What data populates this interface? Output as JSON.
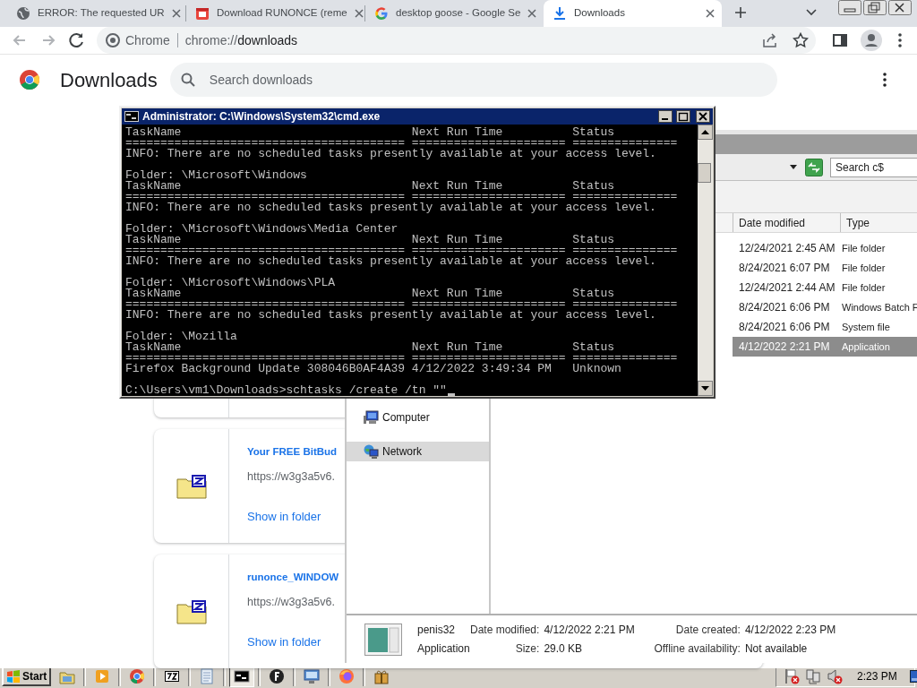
{
  "browser": {
    "tabs": [
      {
        "kind": "globe",
        "title": "ERROR: The requested UR",
        "selected": false
      },
      {
        "kind": "app",
        "title": "Download RUNONCE (reme",
        "selected": false
      },
      {
        "kind": "google",
        "title": "desktop goose - Google Se",
        "selected": false
      },
      {
        "kind": "download",
        "title": "Downloads",
        "selected": true
      }
    ],
    "address": {
      "site_label": "Chrome",
      "prefix": "chrome://",
      "path": "downloads"
    }
  },
  "downloads_page": {
    "title": "Downloads",
    "search": {
      "placeholder": "Search downloads"
    },
    "items": [
      {
        "kind": "covered"
      },
      {
        "kind": "file",
        "name": "Your FREE BitBud",
        "url": "https://w3g3a5v6.",
        "link": "Show in folder"
      },
      {
        "kind": "file",
        "name": "runonce_WINDOW",
        "url": "https://w3g3a5v6.",
        "link": "Show in folder"
      }
    ]
  },
  "explorer": {
    "search": {
      "placeholder": "Search c$"
    },
    "columns": [
      "Date modified",
      "Type"
    ],
    "nav": [
      {
        "label": "Computer",
        "kind": "computer",
        "selected": false
      },
      {
        "label": "Network",
        "kind": "network",
        "selected": true
      }
    ],
    "rows": [
      {
        "date": "12/24/2021 2:45 AM",
        "type": "File folder",
        "selected": false
      },
      {
        "date": "8/24/2021 6:07 PM",
        "type": "File folder",
        "selected": false
      },
      {
        "date": "12/24/2021 2:44 AM",
        "type": "File folder",
        "selected": false
      },
      {
        "date": "8/24/2021 6:06 PM",
        "type": "Windows Batch F",
        "selected": false
      },
      {
        "date": "8/24/2021 6:06 PM",
        "type": "System file",
        "selected": false
      },
      {
        "date": "4/12/2022 2:21 PM",
        "type": "Application",
        "selected": true
      }
    ],
    "details": {
      "name": "penis32",
      "type": "Application",
      "fields": [
        {
          "label": "Date modified:",
          "value": "4/12/2022 2:21 PM"
        },
        {
          "label": "Date created:",
          "value": "4/12/2022 2:23 PM"
        },
        {
          "label": "Size:",
          "value": "29.0 KB"
        },
        {
          "label": "Offline availability:",
          "value": "Not available"
        }
      ]
    }
  },
  "console_window": {
    "title": "Administrator: C:\\Windows\\System32\\cmd.exe",
    "blocks": [
      [
        "TaskName                                 Next Run Time          Status",
        "======================================== ====================== ===============",
        "INFO: There are no scheduled tasks presently available at your access level."
      ],
      [
        "Folder: \\Microsoft\\Windows",
        "TaskName                                 Next Run Time          Status",
        "======================================== ====================== ===============",
        "INFO: There are no scheduled tasks presently available at your access level."
      ],
      [
        "Folder: \\Microsoft\\Windows\\Media Center",
        "TaskName                                 Next Run Time          Status",
        "======================================== ====================== ===============",
        "INFO: There are no scheduled tasks presently available at your access level."
      ],
      [
        "Folder: \\Microsoft\\Windows\\PLA",
        "TaskName                                 Next Run Time          Status",
        "======================================== ====================== ===============",
        "INFO: There are no scheduled tasks presently available at your access level."
      ],
      [
        "Folder: \\Mozilla",
        "TaskName                                 Next Run Time          Status",
        "======================================== ====================== ===============",
        "Firefox Background Update 308046B0AF4A39 4/12/2022 3:49:34 PM   Unknown"
      ],
      [
        "C:\\Users\\vm1\\Downloads>schtasks /create /tn \"\""
      ]
    ]
  },
  "taskbar": {
    "start": "Start",
    "clock": "2:23 PM",
    "apps": [
      {
        "kind": "explorer",
        "active": false
      },
      {
        "kind": "media",
        "active": false
      },
      {
        "kind": "chrome",
        "active": false
      },
      {
        "kind": "archive",
        "active": false
      },
      {
        "kind": "notepad",
        "active": false
      },
      {
        "kind": "console",
        "active": true
      },
      {
        "kind": "circle",
        "active": false
      },
      {
        "kind": "remote",
        "active": false
      },
      {
        "kind": "firefox",
        "active": false
      },
      {
        "kind": "package",
        "active": false
      }
    ]
  }
}
